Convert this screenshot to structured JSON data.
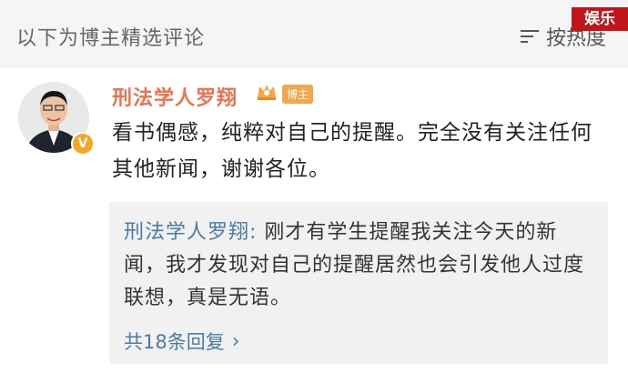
{
  "header": {
    "section_title": "以下为博主精选评论",
    "sort_label": "按热度",
    "sort_icon": "sort-icon"
  },
  "watermark": {
    "label": "娱乐"
  },
  "comment": {
    "author": "刑法学人罗翔",
    "author_color": "#eb7350",
    "role_badge": "博主",
    "verify_badge": "V",
    "text": "看书偶感，纯粹对自己的提醒。完全没有关注任何其他新闻，谢谢各位。"
  },
  "reply": {
    "author": "刑法学人罗翔",
    "separator": ":",
    "text": " 刚才有学生提醒我关注今天的新闻，我才发现对自己的提醒居然也会引发他人过度联想，真是无语。",
    "count_label": "共18条回复",
    "chevron": "›",
    "link_color": "#4b7aa6"
  }
}
